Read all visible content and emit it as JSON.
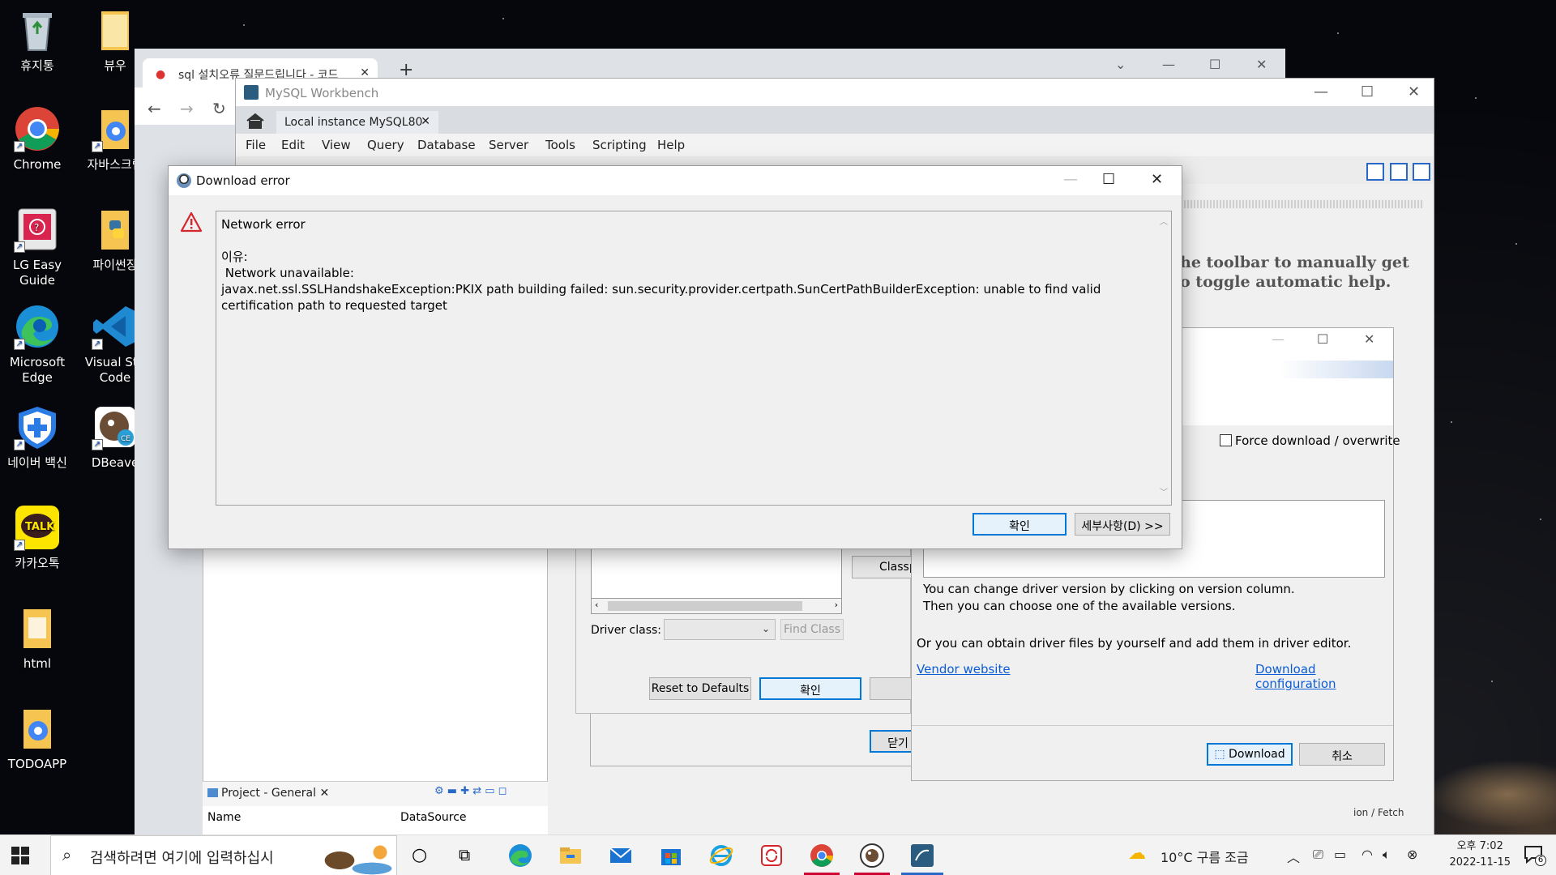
{
  "desktop": {
    "icons": [
      {
        "label": "휴지통",
        "icon": "recycle-bin-icon"
      },
      {
        "label": "뷰우",
        "icon": "folder-icon"
      },
      {
        "label": "Chrome",
        "icon": "chrome-icon"
      },
      {
        "label": "자바스크립",
        "icon": "folder-icon"
      },
      {
        "label": "LG Easy Guide",
        "icon": "lg-guide-icon"
      },
      {
        "label": "파이썬장",
        "icon": "folder-icon"
      },
      {
        "label": "Microsoft Edge",
        "icon": "edge-icon"
      },
      {
        "label": "Visual Stu Code",
        "icon": "vscode-icon"
      },
      {
        "label": "네이버 백신",
        "icon": "naver-vaccine-icon"
      },
      {
        "label": "DBeave",
        "icon": "dbeaver-icon"
      },
      {
        "label": "카카오톡",
        "icon": "kakaotalk-icon"
      },
      {
        "label": "html",
        "icon": "folder-icon"
      },
      {
        "label": "TODOAPP",
        "icon": "folder-icon"
      }
    ]
  },
  "browser": {
    "tab_title": "sql 설치오류 질문드립니다 - 코드",
    "new_tab": "+"
  },
  "workbench": {
    "title": "MySQL Workbench",
    "tab": "Local instance MySQL80",
    "menu": [
      "File",
      "Edit",
      "View",
      "Query",
      "Database",
      "Server",
      "Tools",
      "Scripting",
      "Help"
    ],
    "help_text_line1": "he toolbar to manually get",
    "help_text_line2": "o toggle automatic help.",
    "project_panel": {
      "tab": "Project - General",
      "col_name": "Name",
      "col_datasource": "DataSource"
    },
    "bottom_right_label": "ion / Fetch",
    "close_button": "닫기"
  },
  "driver_dialog": {
    "classpath_button": "Classp",
    "driver_class_label": "Driver class:",
    "find_class_button": "Find Class",
    "reset_button": "Reset to Defaults",
    "ok_button": "확인"
  },
  "download_dialog": {
    "force_checkbox": "Force download / overwrite",
    "info_line1": "You can change driver version by clicking on version column.",
    "info_line2": "Then you can choose one of the available versions.",
    "obtain_text": "Or you can obtain driver files by yourself and add them in driver editor.",
    "vendor_link": "Vendor website",
    "config_link": "Download configuration",
    "download_button": "Download",
    "cancel_button": "취소"
  },
  "error_dialog": {
    "title": "Download error",
    "heading": "Network error",
    "reason_label": "이유:",
    "reason_line": " Network unavailable:",
    "exception_line": "javax.net.ssl.SSLHandshakeException:PKIX path building failed: sun.security.provider.certpath.SunCertPathBuilderException: unable to find valid certification path to requested target",
    "ok_button": "확인",
    "details_button": "세부사항(D) >>"
  },
  "taskbar": {
    "search_placeholder": "검색하려면 여기에 입력하십시",
    "weather": "10°C  구름 조금",
    "time": "오후 7:02",
    "date": "2022-11-15",
    "notification_count": "6"
  }
}
